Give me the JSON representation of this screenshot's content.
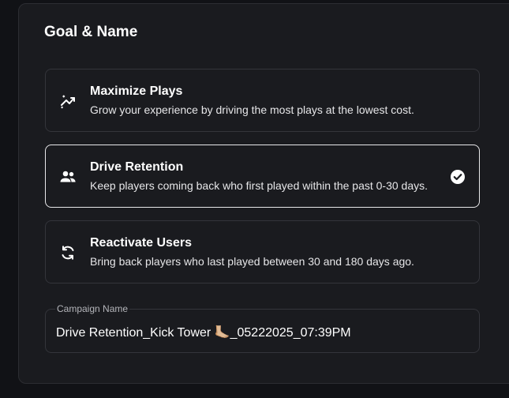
{
  "section": {
    "title": "Goal & Name"
  },
  "goals": [
    {
      "title": "Maximize Plays",
      "description": "Grow your experience by driving the most plays at the lowest cost.",
      "icon": "trending-up-icon",
      "selected": false
    },
    {
      "title": "Drive Retention",
      "description": "Keep players coming back who first played within the past 0-30 days.",
      "icon": "people-icon",
      "selected": true
    },
    {
      "title": "Reactivate Users",
      "description": "Bring back players who last played between 30 and 180 days ago.",
      "icon": "refresh-icon",
      "selected": false
    }
  ],
  "campaign": {
    "label": "Campaign Name",
    "value": "Drive Retention_Kick Tower 🦶🏼_05222025_07:39PM"
  },
  "colors": {
    "background": "#111216",
    "panel": "#1a1b1f",
    "border": "#34353b",
    "selected_border": "#e8e8ea",
    "text": "#ffffff"
  }
}
